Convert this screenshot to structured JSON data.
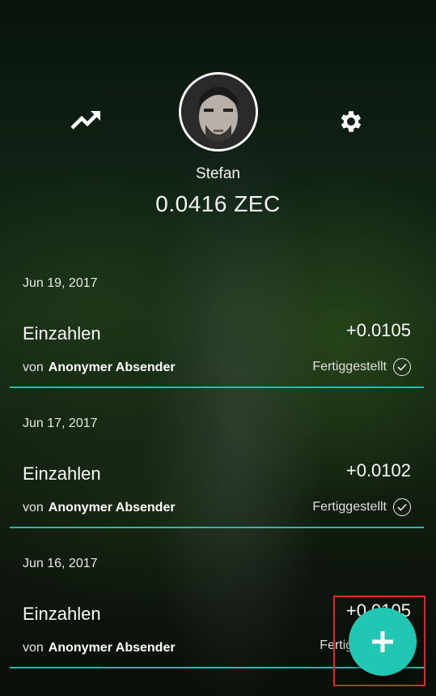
{
  "header": {
    "username": "Stefan",
    "balance": "0.0416 ZEC",
    "left_icon": "trending-up-icon",
    "right_icon": "gear-icon"
  },
  "transactions": [
    {
      "date": "Jun 19, 2017",
      "type": "Einzahlen",
      "amount": "+0.0105",
      "from_prefix": "von",
      "from_name": "Anonymer Absender",
      "status": "Fertiggestellt"
    },
    {
      "date": "Jun 17, 2017",
      "type": "Einzahlen",
      "amount": "+0.0102",
      "from_prefix": "von",
      "from_name": "Anonymer Absender",
      "status": "Fertiggestellt"
    },
    {
      "date": "Jun 16, 2017",
      "type": "Einzahlen",
      "amount": "+0.0105",
      "from_prefix": "von",
      "from_name": "Anonymer Absender",
      "status": "Fertigge"
    }
  ],
  "fab": {
    "icon": "plus-icon"
  },
  "colors": {
    "accent": "#22c7b3",
    "divider": "#1fbfae",
    "highlight": "#e3262d"
  }
}
